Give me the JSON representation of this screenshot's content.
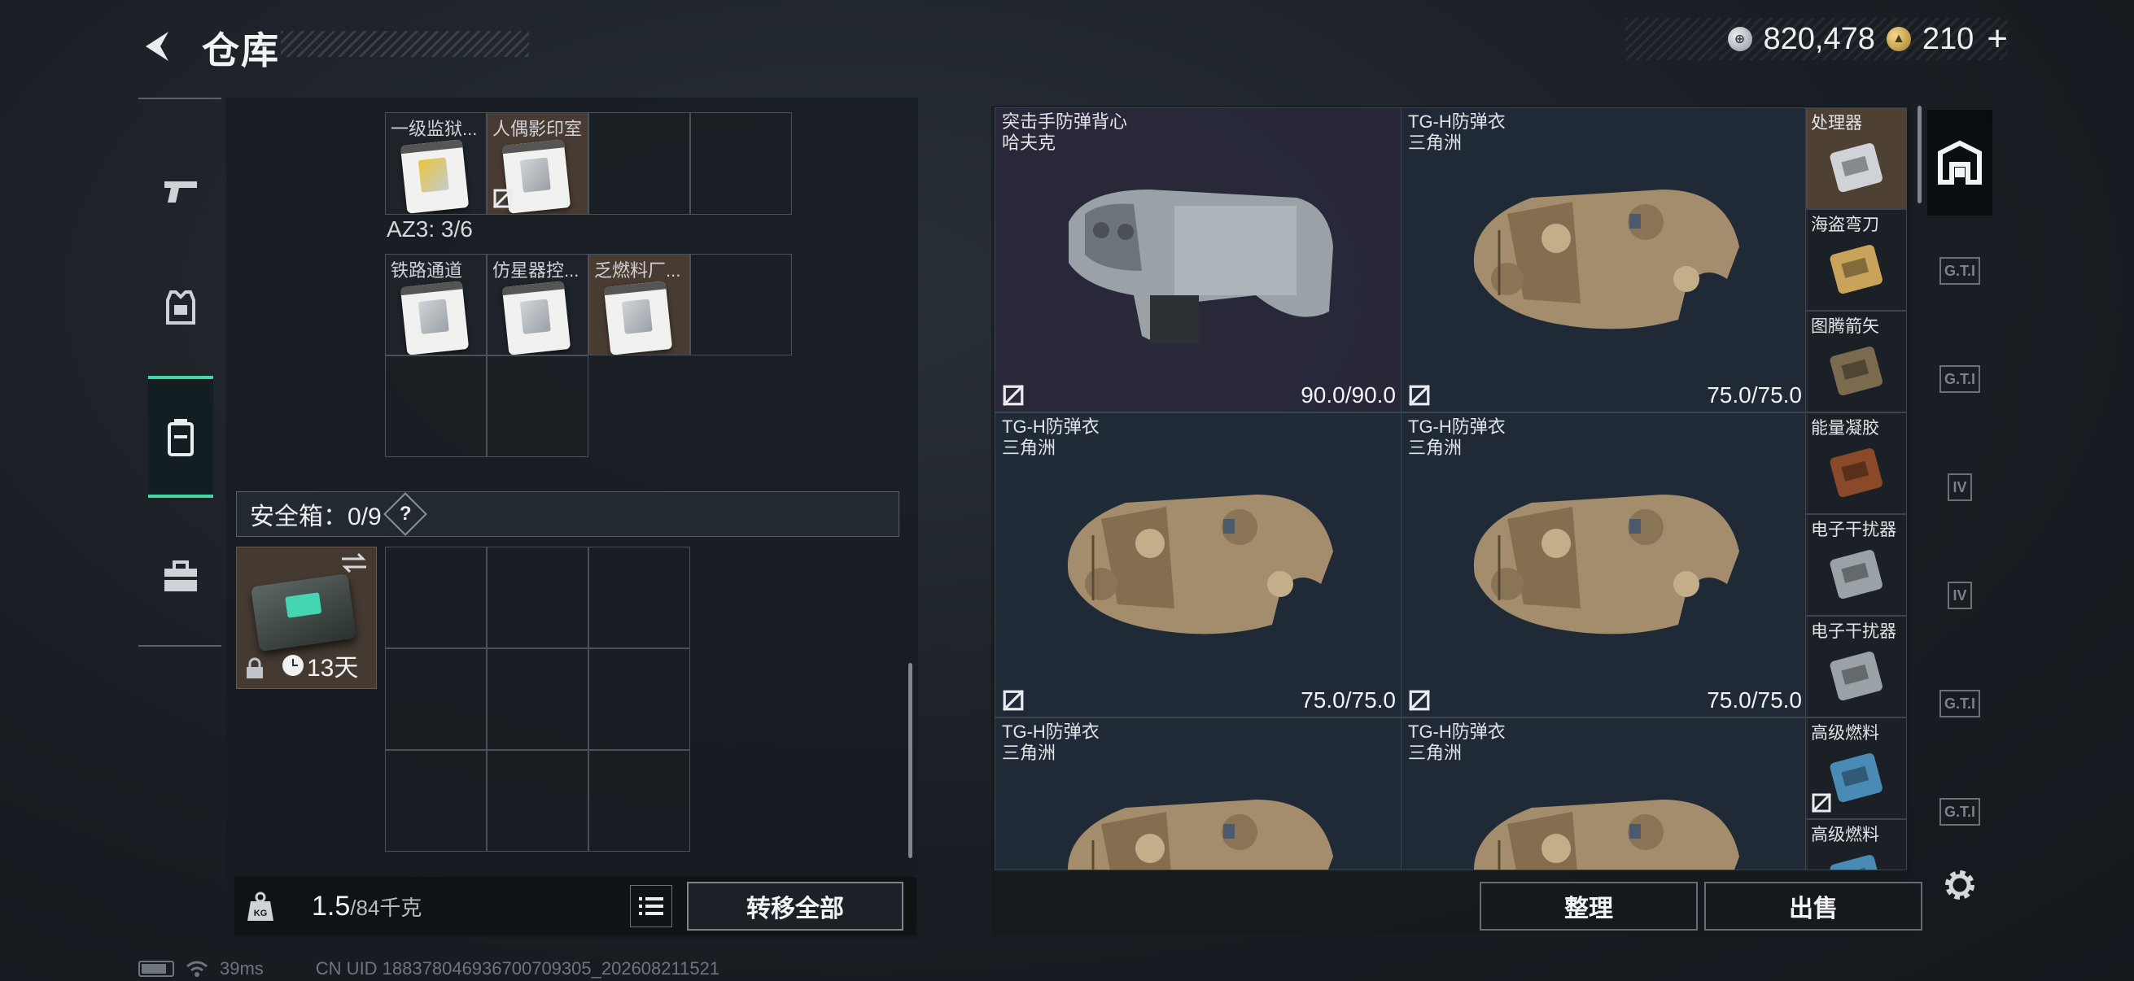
{
  "header": {
    "title": "仓库",
    "currency_silver": "820,478",
    "currency_gold": "210",
    "plus_label": "+",
    "silver_icon": "silver-coin-icon",
    "gold_icon": "gold-coin-icon"
  },
  "left_nav": {
    "items": [
      {
        "name": "pistol-icon"
      },
      {
        "name": "armor-icon"
      },
      {
        "name": "backpack-icon",
        "active": true
      },
      {
        "name": "toolbox-icon"
      }
    ]
  },
  "keycards": {
    "row1": [
      {
        "label": "一级监狱...",
        "kind": "yellow"
      },
      {
        "label": "人偶影印室",
        "kind": "white",
        "nolock": true
      }
    ],
    "az_label": "AZ3: 3/6",
    "row2": [
      {
        "label": "铁路通道",
        "kind": "yellow"
      },
      {
        "label": "仿星器控...",
        "kind": "yellow"
      },
      {
        "label": "乏燃料厂...",
        "kind": "yellow"
      }
    ]
  },
  "safebox": {
    "label": "安全箱：0/9",
    "help": "?",
    "timer": "13天"
  },
  "bottom_left": {
    "weight_main": "1.5",
    "weight_rest": "/84千克",
    "kg_icon": "KG",
    "transfer_label": "转移全部"
  },
  "vests": [
    {
      "line1": "突击手防弹背心",
      "line2": "哈夫克",
      "durability": "90.0/90.0",
      "style": "urban",
      "bg": "purple"
    },
    {
      "line1": "TG-H防弹衣",
      "line2": "三角洲",
      "durability": "75.0/75.0",
      "style": "desert",
      "bg": "blue"
    },
    {
      "line1": "TG-H防弹衣",
      "line2": "三角洲",
      "durability": "75.0/75.0",
      "style": "desert",
      "bg": "blue"
    },
    {
      "line1": "TG-H防弹衣",
      "line2": "三角洲",
      "durability": "75.0/75.0",
      "style": "desert",
      "bg": "blue"
    },
    {
      "line1": "TG-H防弹衣",
      "line2": "三角洲",
      "durability": "",
      "style": "desert",
      "bg": "blue"
    },
    {
      "line1": "TG-H防弹衣",
      "line2": "三角洲",
      "durability": "",
      "style": "desert",
      "bg": "blue"
    }
  ],
  "small_items": [
    {
      "label": "处理器",
      "brown": true
    },
    {
      "label": "海盗弯刀"
    },
    {
      "label": "图腾箭矢"
    },
    {
      "label": "能量凝胶"
    },
    {
      "label": "电子干扰器"
    },
    {
      "label": "电子干扰器"
    },
    {
      "label": "高级燃料",
      "nolock": true
    },
    {
      "label": "高级燃料"
    }
  ],
  "right_tabs": [
    {
      "label": "",
      "icon": "vault-icon",
      "active": true
    },
    {
      "label": "G.T.I"
    },
    {
      "label": "G.T.I"
    },
    {
      "label": "IV"
    },
    {
      "label": "IV"
    },
    {
      "label": "G.T.I"
    },
    {
      "label": "G.T.I"
    }
  ],
  "actions": {
    "sort_label": "整理",
    "sell_label": "出售"
  },
  "status_bar": {
    "ping": "39ms",
    "uid": "CN UID 188378046936700709305_202608211521"
  },
  "colors": {
    "accent": "#3fd9a4",
    "purple_cell": "#2c2a3e",
    "brown_cell": "#5c4a38"
  }
}
